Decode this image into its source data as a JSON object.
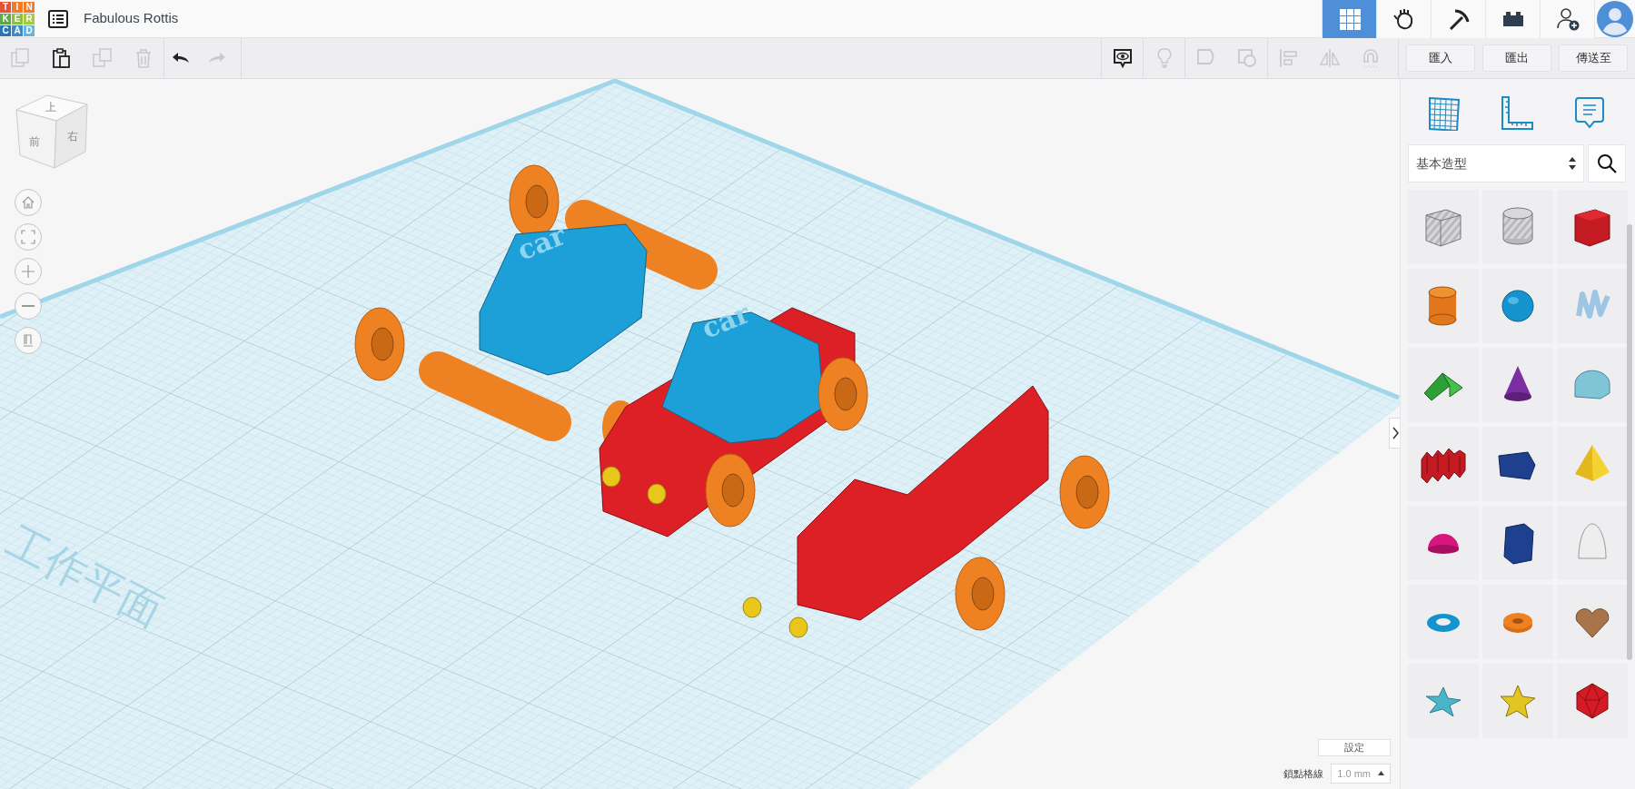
{
  "app": {
    "logo_letters": [
      {
        "letter": "T",
        "color": "#e8502f"
      },
      {
        "letter": "I",
        "color": "#ee7d2a"
      },
      {
        "letter": "N",
        "color": "#ee7d2a"
      },
      {
        "letter": "K",
        "color": "#5fa845"
      },
      {
        "letter": "E",
        "color": "#8dc03f"
      },
      {
        "letter": "R",
        "color": "#a6c83c"
      },
      {
        "letter": "C",
        "color": "#2a75b8"
      },
      {
        "letter": "A",
        "color": "#3a8ccc"
      },
      {
        "letter": "D",
        "color": "#6ab3e0"
      }
    ],
    "design_title": "Fabulous Rottis"
  },
  "top_nav": [
    {
      "selected": true
    },
    {
      "selected": false
    },
    {
      "selected": false
    },
    {
      "selected": false
    }
  ],
  "toolbar": {
    "edit_tools": [
      {
        "disabled": true
      },
      {
        "disabled": false
      },
      {
        "disabled": true
      },
      {
        "disabled": true
      }
    ],
    "history": [
      {
        "disabled": false
      },
      {
        "disabled": true
      }
    ],
    "view_tools": [
      {
        "disabled": false
      },
      {
        "disabled": true
      },
      {
        "disabled": true
      },
      {
        "disabled": true
      },
      {
        "disabled": true
      },
      {
        "disabled": true
      },
      {
        "disabled": true
      }
    ],
    "actions": [
      "匯入",
      "匯出",
      "傳送至"
    ]
  },
  "view_cube": {
    "faces": [
      "上",
      "前",
      "右"
    ]
  },
  "workplane": {
    "label": "工作平面",
    "model_texts": [
      "car",
      "car"
    ]
  },
  "panel": {
    "category": "基本造型"
  },
  "footer": {
    "settings": "設定",
    "snap_label": "鎖點格線",
    "snap_value": "1.0 mm"
  }
}
